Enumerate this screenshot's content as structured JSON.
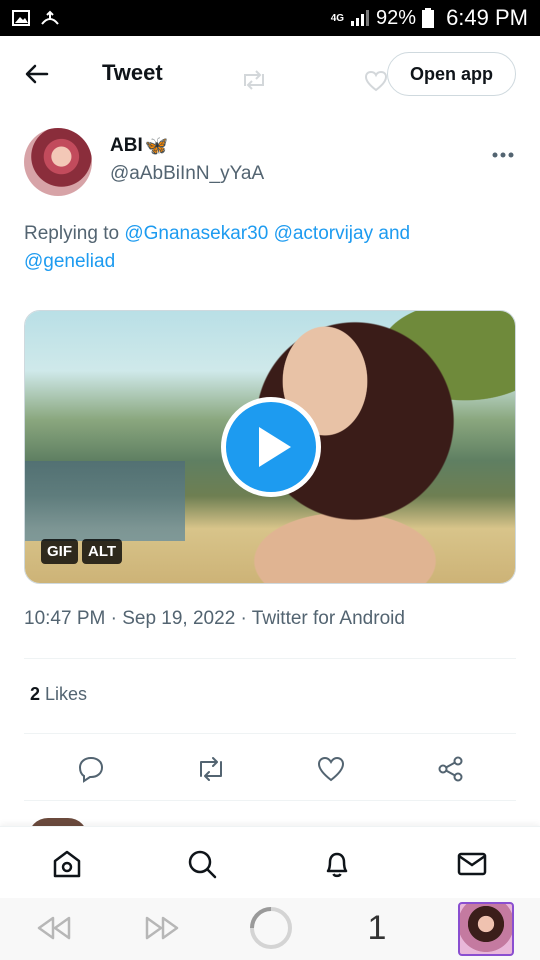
{
  "status_bar": {
    "network": "4G",
    "battery": "92%",
    "time": "6:49 PM"
  },
  "header": {
    "title": "Tweet",
    "open_app": "Open app"
  },
  "tweet": {
    "author_name": "ABI",
    "author_emoji": "🦋",
    "author_handle": "@aAbBiInN_yYaA",
    "replying_prefix": "Replying to",
    "mention_1": "@Gnanasekar30",
    "mention_2": "@actorvijay",
    "replying_and": "and",
    "mention_3": "@geneliad",
    "media_badges": [
      "GIF",
      "ALT"
    ],
    "timestamp": "10:47 PM · Sep 19, 2022 · Twitter for Android",
    "likes_count": "2",
    "likes_label": "Likes"
  },
  "bottom_nav": {
    "items": [
      "home-icon",
      "search-icon",
      "notifications-icon",
      "messages-icon"
    ]
  },
  "browser_toolbar": {
    "tab_count": "1"
  },
  "colors": {
    "accent": "#1d9bf0",
    "text_secondary": "#536471"
  }
}
